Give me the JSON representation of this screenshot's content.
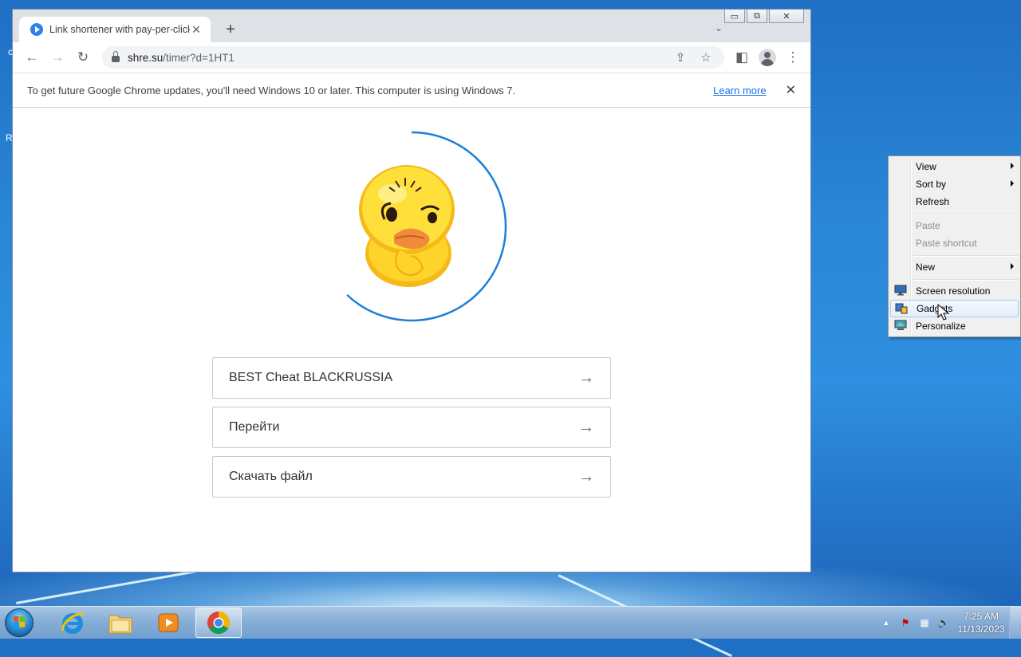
{
  "desktop": {
    "fragments": [
      "c",
      "R"
    ]
  },
  "browser": {
    "tab": {
      "title": "Link shortener with pay-per-click",
      "close": "✕"
    },
    "new_tab": "+",
    "tab_search": "⌄",
    "caption": {
      "minimize": "▭",
      "restore": "⧉",
      "close": "✕"
    },
    "nav": {
      "back": "←",
      "forward": "→",
      "reload": "↻"
    },
    "omnibox": {
      "host": "shre.su",
      "path": "/timer?d=1HT1",
      "share": "⇪",
      "star": "☆"
    },
    "toolbar": {
      "side_panel": "◧",
      "menu": "⋮"
    },
    "infobar": {
      "message": "To get future Google Chrome updates, you'll need Windows 10 or later. This computer is using Windows 7.",
      "link": "Learn more",
      "close": "✕"
    },
    "page": {
      "timer_progress": 0.62,
      "links": [
        {
          "label": "BEST Cheat BLACKRUSSIA",
          "arrow": "→"
        },
        {
          "label": "Перейти",
          "arrow": "→"
        },
        {
          "label": "Скачать файл",
          "arrow": "→"
        }
      ]
    }
  },
  "context_menu": {
    "items": [
      {
        "label": "View",
        "submenu": true,
        "enabled": true
      },
      {
        "label": "Sort by",
        "submenu": true,
        "enabled": true
      },
      {
        "label": "Refresh",
        "submenu": false,
        "enabled": true
      },
      {
        "label": "Paste",
        "submenu": false,
        "enabled": false
      },
      {
        "label": "Paste shortcut",
        "submenu": false,
        "enabled": false
      },
      {
        "label": "New",
        "submenu": true,
        "enabled": true
      },
      {
        "label": "Screen resolution",
        "icon": "monitor-icon",
        "enabled": true
      },
      {
        "label": "Gadgets",
        "icon": "gadgets-icon",
        "enabled": true,
        "highlighted": true
      },
      {
        "label": "Personalize",
        "icon": "personalize-icon",
        "enabled": true
      }
    ]
  },
  "taskbar": {
    "apps": [
      "internet-explorer",
      "windows-explorer",
      "media-player",
      "google-chrome"
    ],
    "active_app": "google-chrome",
    "tray": {
      "show_hidden": "▲",
      "flag": "⚑",
      "network": "▦",
      "volume": "🔈"
    },
    "clock": {
      "time": "7:25 AM",
      "date": "11/13/2023"
    }
  },
  "colors": {
    "accent_blue": "#1a73e8",
    "timer_ring": "#1e7fd9",
    "duck_yellow": "#ffd42a",
    "duck_beak": "#f28a3c"
  }
}
